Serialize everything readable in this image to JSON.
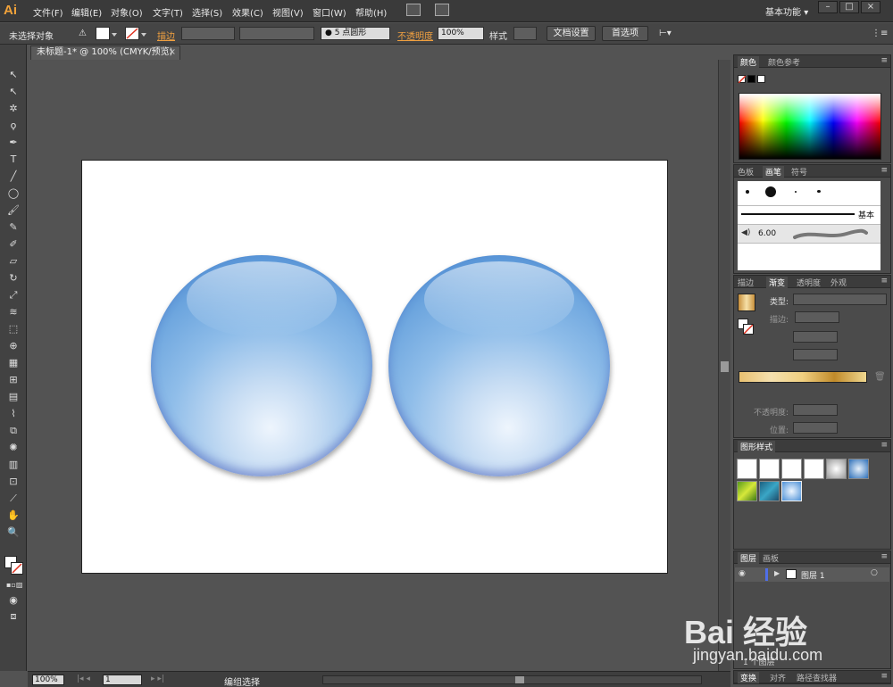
{
  "app": {
    "logo": "Ai"
  },
  "menu": [
    "文件(F)",
    "编辑(E)",
    "对象(O)",
    "文字(T)",
    "选择(S)",
    "效果(C)",
    "视图(V)",
    "窗口(W)",
    "帮助(H)"
  ],
  "workspace": {
    "label": "基本功能",
    "arrow": "▾"
  },
  "window_controls": {
    "minimize": "–",
    "maximize": "□",
    "close": "×"
  },
  "control_bar": {
    "selection": "未选择对象",
    "stroke_label": "描边",
    "brush_size": "5 点圆形",
    "opacity_label": "不透明度",
    "opacity_value": "100%",
    "style_label": "样式",
    "doc_setup": "文档设置",
    "preferences": "首选项"
  },
  "document": {
    "tab_title": "未标题-1* @ 100% (CMYK/预览)",
    "tab_close": "×"
  },
  "status": {
    "zoom": "100%",
    "artboard": "1",
    "mode": "编组选择"
  },
  "colors": {
    "accent": "#f2a33a",
    "panel_bg": "#4b4b4b",
    "sphere_base": "#6fa7df"
  },
  "panels": {
    "color": {
      "tabs": [
        "颜色",
        "颜色参考"
      ],
      "active": 0
    },
    "brushes": {
      "tabs": [
        "色板",
        "画笔",
        "符号"
      ],
      "active": 1,
      "basic": "基本",
      "size": "6.00"
    },
    "gradient": {
      "tabs": [
        "描边",
        "渐变",
        "透明度",
        "外观"
      ],
      "active": 1,
      "type_label": "类型:",
      "stroke_label": "描边:",
      "opacity_label": "不透明度:",
      "position_label": "位置:"
    },
    "graphic_styles": {
      "tabs": [
        "图形样式"
      ],
      "active": 0
    },
    "layers": {
      "tabs": [
        "图层",
        "画板"
      ],
      "active": 0,
      "layer_name": "图层 1",
      "count": "1 个图层"
    },
    "bottom": {
      "tabs": [
        "变换",
        "对齐",
        "路径查找器"
      ],
      "active": 0
    }
  },
  "watermark": {
    "brand": "Bai 经验",
    "url": "jingyan.baidu.com"
  }
}
